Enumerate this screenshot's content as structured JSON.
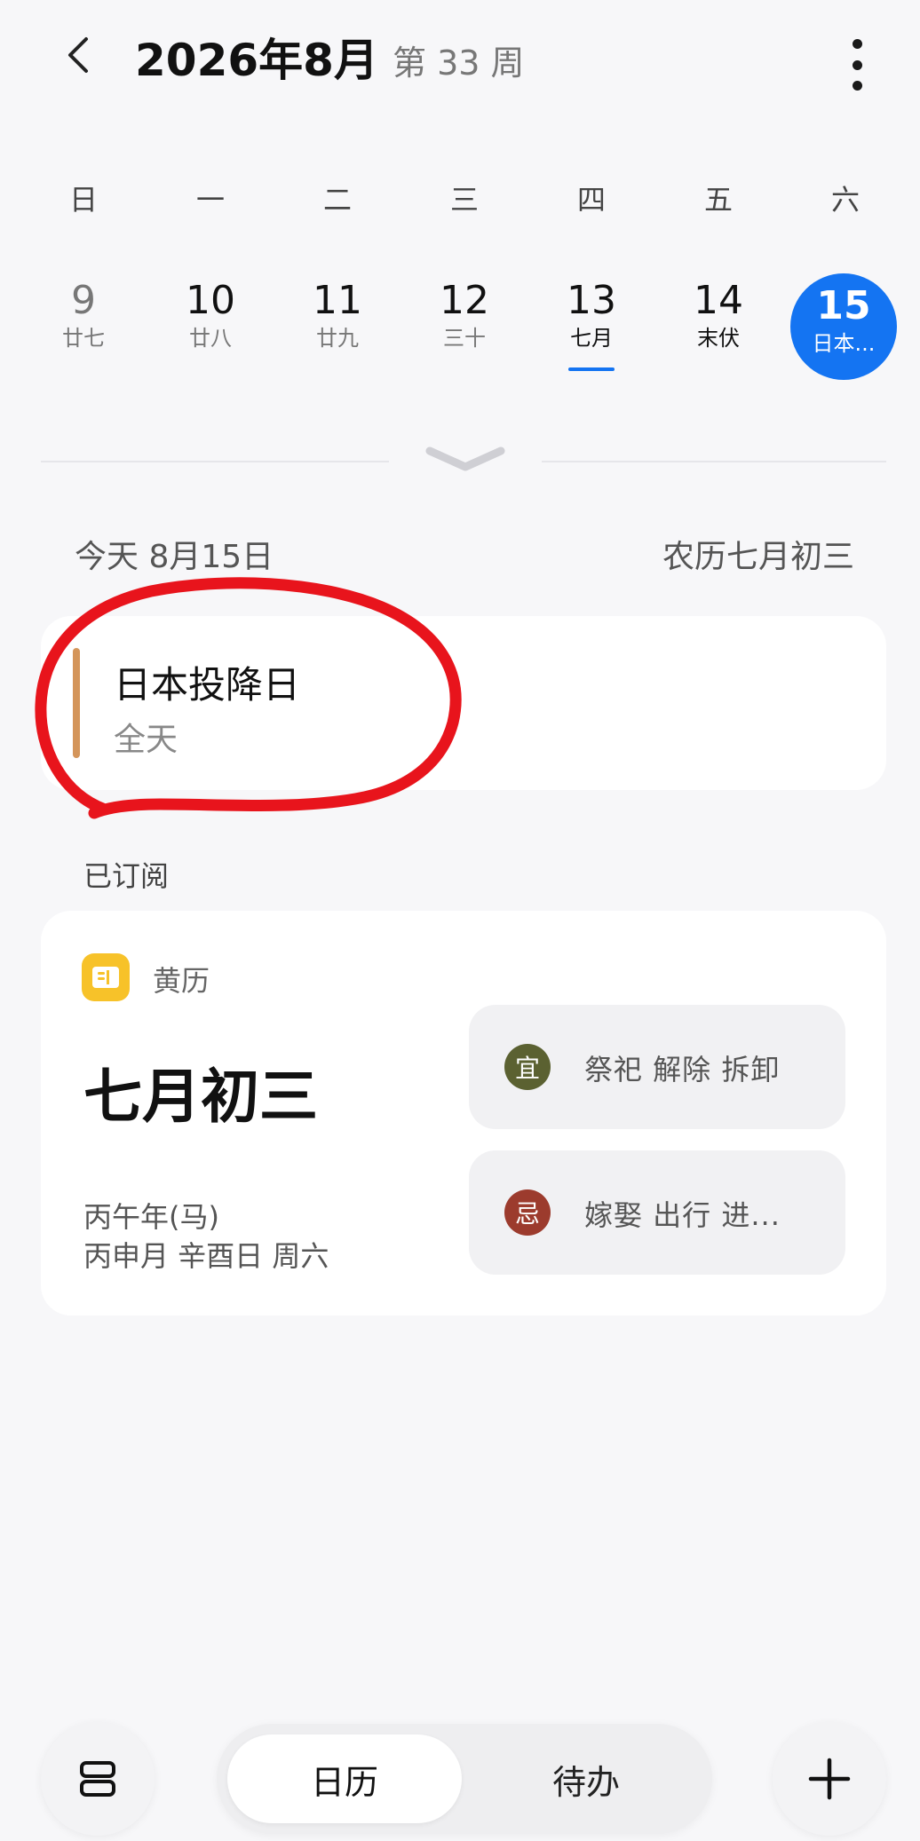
{
  "header": {
    "title": "2026年8月",
    "week_label": "第 33 周"
  },
  "week": {
    "weekdays": [
      "日",
      "一",
      "二",
      "三",
      "四",
      "五",
      "六"
    ],
    "days": [
      {
        "num": "9",
        "lunar": "廿七"
      },
      {
        "num": "10",
        "lunar": "廿八"
      },
      {
        "num": "11",
        "lunar": "廿九"
      },
      {
        "num": "12",
        "lunar": "三十"
      },
      {
        "num": "13",
        "lunar": "七月"
      },
      {
        "num": "14",
        "lunar": "末伏"
      },
      {
        "num": "15",
        "lunar": "日本..."
      }
    ],
    "selected_index": 6,
    "today_index": 4
  },
  "date_row": {
    "today": "今天  8月15日",
    "lunar": "农历七月初三"
  },
  "event": {
    "title": "日本投降日",
    "subtitle": "全天",
    "bar_color": "#d4955a"
  },
  "annotation": {
    "color": "#e8141c"
  },
  "subscribed": {
    "label": "已订阅",
    "almanac": {
      "name": "黄历",
      "lunar_date": "七月初三",
      "year": "丙午年(马)",
      "ganzhi": "丙申月 辛酉日 周六",
      "yi": {
        "badge": "宜",
        "text": "祭祀  解除  拆卸",
        "color": "#5b6131"
      },
      "ji": {
        "badge": "忌",
        "text": "嫁娶  出行  进...",
        "color": "#9c3b2d"
      }
    }
  },
  "bottom": {
    "tab_calendar": "日历",
    "tab_todo": "待办",
    "layout_icon": "layout-toggle-icon",
    "add_icon": "plus-icon"
  },
  "colors": {
    "accent": "#1474f2",
    "almanac_icon": "#f7c229"
  }
}
